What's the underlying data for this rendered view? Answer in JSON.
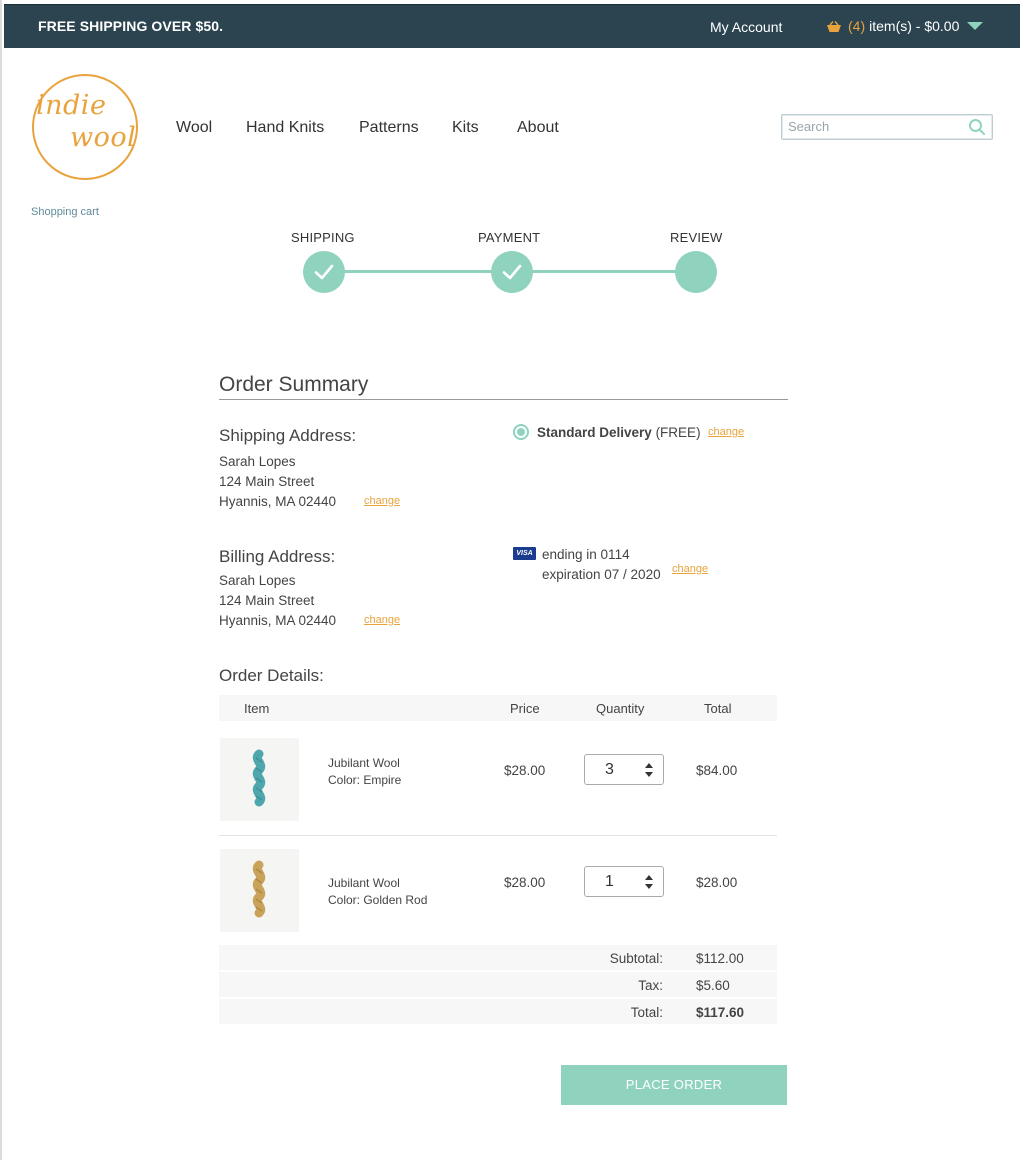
{
  "topbar": {
    "shipping_notice": "FREE SHIPPING OVER $50.",
    "my_account": "My Account",
    "cart_count": "(4)",
    "cart_summary": "item(s) - $0.00",
    "accent_color": "#e8a33d",
    "bar_color": "#2b4450"
  },
  "logo": {
    "line1": "indie",
    "line2": "wool"
  },
  "nav": {
    "items": [
      "Wool",
      "Hand Knits",
      "Patterns",
      "Kits",
      "About"
    ]
  },
  "search": {
    "placeholder": "Search"
  },
  "breadcrumb": "Shopping cart",
  "steps": {
    "items": [
      {
        "label": "SHIPPING",
        "done": true
      },
      {
        "label": "PAYMENT",
        "done": true
      },
      {
        "label": "REVIEW",
        "done": false
      }
    ],
    "color": "#8fd3bf"
  },
  "summary": {
    "title": "Order Summary",
    "shipping_heading": "Shipping Address:",
    "shipping_name": "Sarah Lopes",
    "shipping_street": "124 Main Street",
    "shipping_city": "Hyannis, MA 02440",
    "billing_heading": "Billing Address:",
    "billing_name": "Sarah Lopes",
    "billing_street": "124 Main Street",
    "billing_city": "Hyannis, MA 02440",
    "delivery_method": "Standard Delivery",
    "delivery_cost": "(FREE)",
    "card_brand": "VISA",
    "card_ending": "ending in 0114",
    "card_expiration": "expiration 07 / 2020",
    "change_label": "change"
  },
  "order_details": {
    "heading": "Order Details:",
    "columns": [
      "Item",
      "Price",
      "Quantity",
      "Total"
    ],
    "items": [
      {
        "name": "Jubilant Wool",
        "color": "Color: Empire",
        "price": "$28.00",
        "quantity": "3",
        "total": "$84.00",
        "swatch": "#4fa7ae"
      },
      {
        "name": "Jubilant Wool",
        "color": "Color: Golden Rod",
        "price": "$28.00",
        "quantity": "1",
        "total": "$28.00",
        "swatch": "#c9a35a"
      }
    ],
    "subtotal_label": "Subtotal:",
    "subtotal": "$112.00",
    "tax_label": "Tax:",
    "tax": "$5.60",
    "total_label": "Total:",
    "total": "$117.60"
  },
  "place_order": "PLACE ORDER"
}
